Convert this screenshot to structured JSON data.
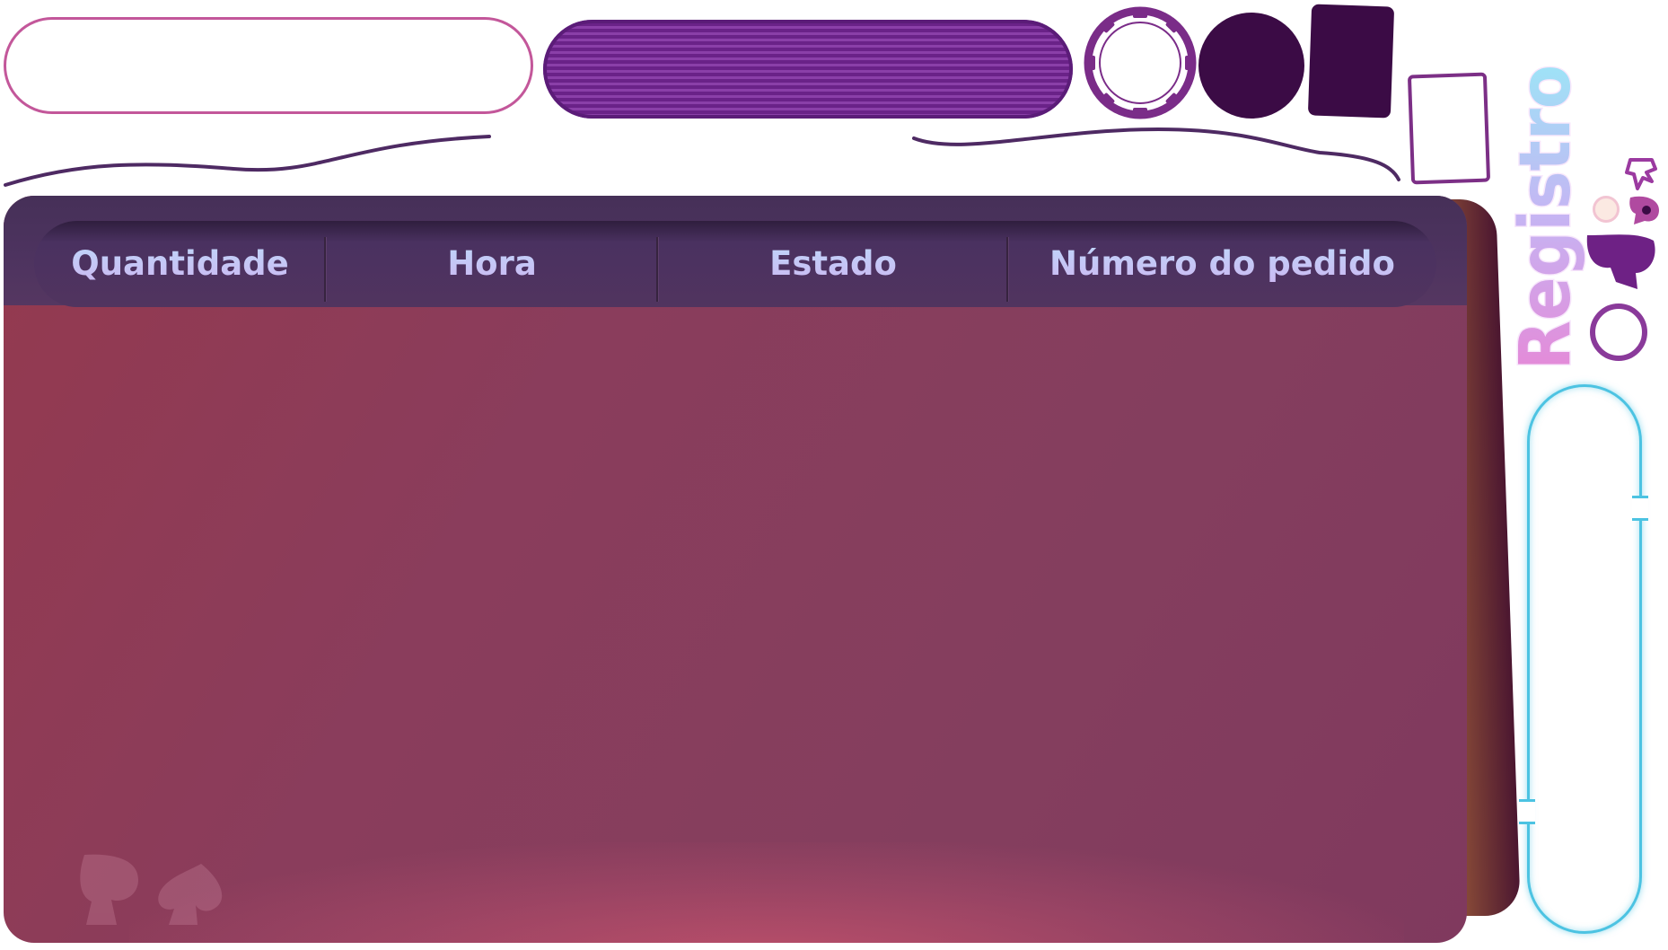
{
  "header": {
    "columns": [
      "Quantidade",
      "Hora",
      "Estado",
      "Número do pedido"
    ]
  },
  "side": {
    "title": "Registro"
  },
  "colors": {
    "panel": "#8a3d5c",
    "header_bar": "#4d335f",
    "header_text": "#c7d6fb",
    "accent_pink": "#c3579a",
    "accent_purple": "#6a2288",
    "dark_purple": "#3b0b45",
    "scroll_cyan": "#4cc3e2"
  },
  "icons": {
    "chip": "poker-chip-icon",
    "spade": "spade-icon",
    "card_back": "card-back-icon",
    "card_outline": "card-outline-icon",
    "ring": "ring-icon"
  }
}
